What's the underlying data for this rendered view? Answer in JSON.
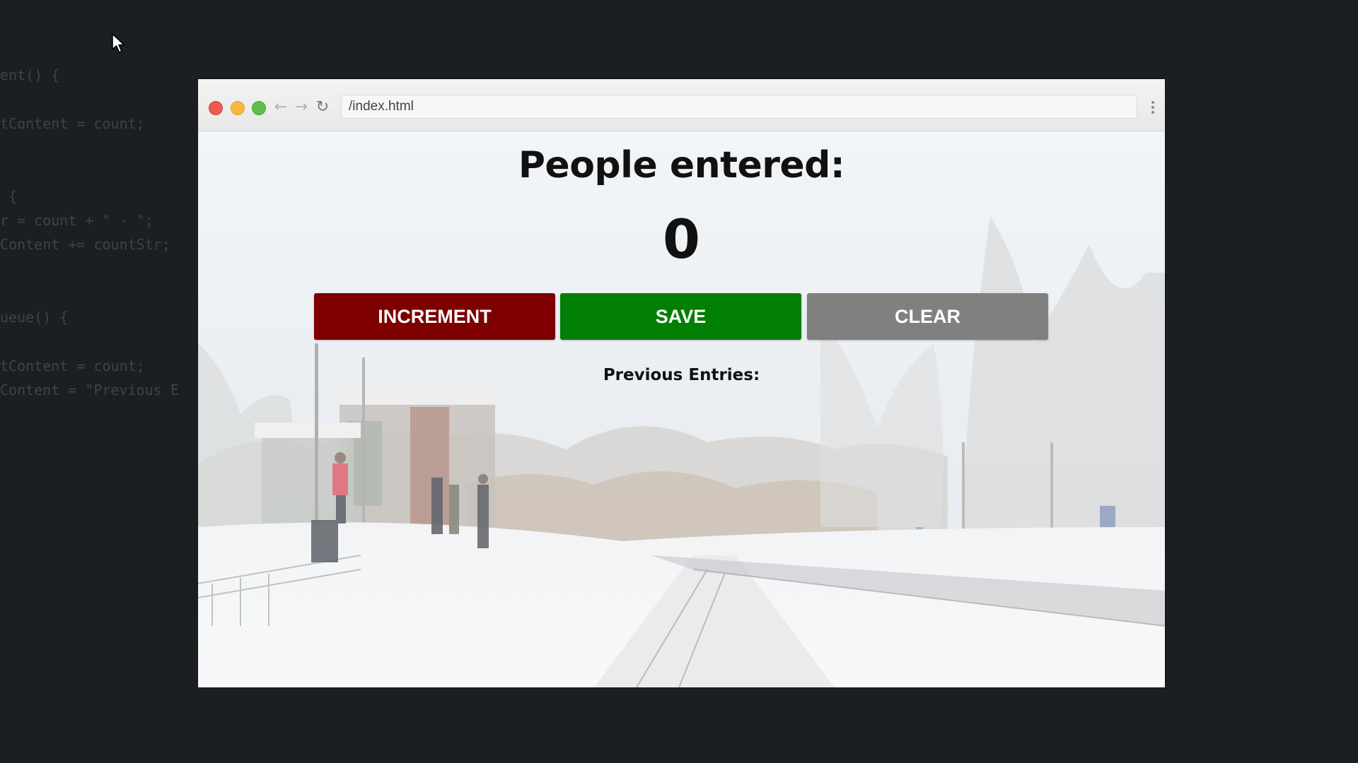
{
  "background_code": {
    "lines": [
      "ent() {",
      "tContent = count;",
      " {",
      "r = count + \" - \";",
      "Content += countStr;",
      "ueue() {",
      "tContent = count;",
      "Content = \"Previous E"
    ]
  },
  "cursor": {
    "icon": "mouse-pointer-icon"
  },
  "browser": {
    "url": "/index.html",
    "controls": {
      "close_color": "#ee5a4f",
      "minimize_color": "#f5b83c",
      "maximize_color": "#5ac04a",
      "back_icon": "←",
      "forward_icon": "→",
      "reload_icon": "↻"
    }
  },
  "page": {
    "heading": "People entered:",
    "count": "0",
    "buttons": {
      "increment": "INCREMENT",
      "save": "SAVE",
      "clear": "CLEAR"
    },
    "button_colors": {
      "increment": "#7e0000",
      "save": "#027f05",
      "clear": "#808080"
    },
    "previous_entries_label": "Previous Entries:",
    "background": "snowy train station platform photo"
  }
}
